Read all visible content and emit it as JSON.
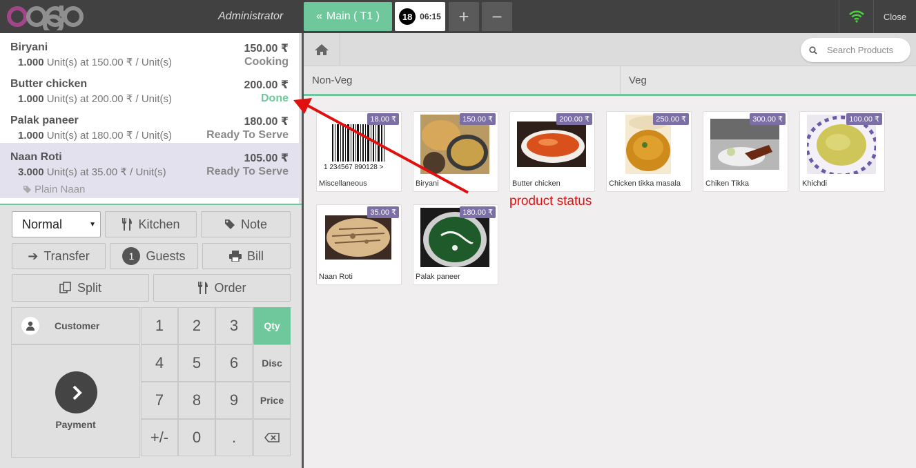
{
  "topbar": {
    "logo_text": "odoo",
    "user": "Administrator",
    "main_tab": "Main ( T1 )",
    "order_number": "18",
    "order_time": "06:15",
    "close_label": "Close"
  },
  "orderlines": [
    {
      "name": "Biryani",
      "price": "150.00 ₹",
      "qty": "1.000",
      "unit_info": "Unit(s) at 150.00 ₹ / Unit(s)",
      "status": "Cooking"
    },
    {
      "name": "Butter chicken",
      "price": "200.00 ₹",
      "qty": "1.000",
      "unit_info": "Unit(s) at 200.00 ₹ / Unit(s)",
      "status": "Done"
    },
    {
      "name": "Palak paneer",
      "price": "180.00 ₹",
      "qty": "1.000",
      "unit_info": "Unit(s) at 180.00 ₹ / Unit(s)",
      "status": "Ready To Serve"
    },
    {
      "name": "Naan Roti",
      "price": "105.00 ₹",
      "qty": "3.000",
      "unit_info": "Unit(s) at 35.00 ₹ / Unit(s)",
      "status": "Ready To Serve",
      "note": "Plain Naan"
    }
  ],
  "actions": {
    "priority_selected": "Normal",
    "kitchen": "Kitchen",
    "note": "Note",
    "transfer": "Transfer",
    "guests_count": "1",
    "guests": "Guests",
    "bill": "Bill",
    "split": "Split",
    "order": "Order"
  },
  "pad": {
    "customer": "Customer",
    "payment": "Payment",
    "keys": [
      "1",
      "2",
      "3",
      "4",
      "5",
      "6",
      "7",
      "8",
      "9",
      "+/-",
      "0",
      "."
    ],
    "modes": [
      "Qty",
      "Disc",
      "Price"
    ]
  },
  "search": {
    "placeholder": "Search Products"
  },
  "categories": [
    "Non-Veg",
    "Veg"
  ],
  "products": [
    {
      "name": "Miscellaneous",
      "price": "18.00 ₹",
      "barcode": "1 234567 890128 >"
    },
    {
      "name": "Biryani",
      "price": "150.00 ₹"
    },
    {
      "name": "Butter chicken",
      "price": "200.00 ₹"
    },
    {
      "name": "Chicken tikka masala",
      "price": "250.00 ₹"
    },
    {
      "name": "Chiken Tikka",
      "price": "300.00 ₹"
    },
    {
      "name": "Khichdi",
      "price": "100.00 ₹"
    },
    {
      "name": "Naan Roti",
      "price": "35.00 ₹"
    },
    {
      "name": "Palak paneer",
      "price": "180.00 ₹"
    }
  ],
  "annotation": "product status",
  "colors": {
    "accent": "#6ec89b",
    "topbar": "#414141",
    "price_tag": "#7c6fa5",
    "annotation": "#e01010"
  }
}
